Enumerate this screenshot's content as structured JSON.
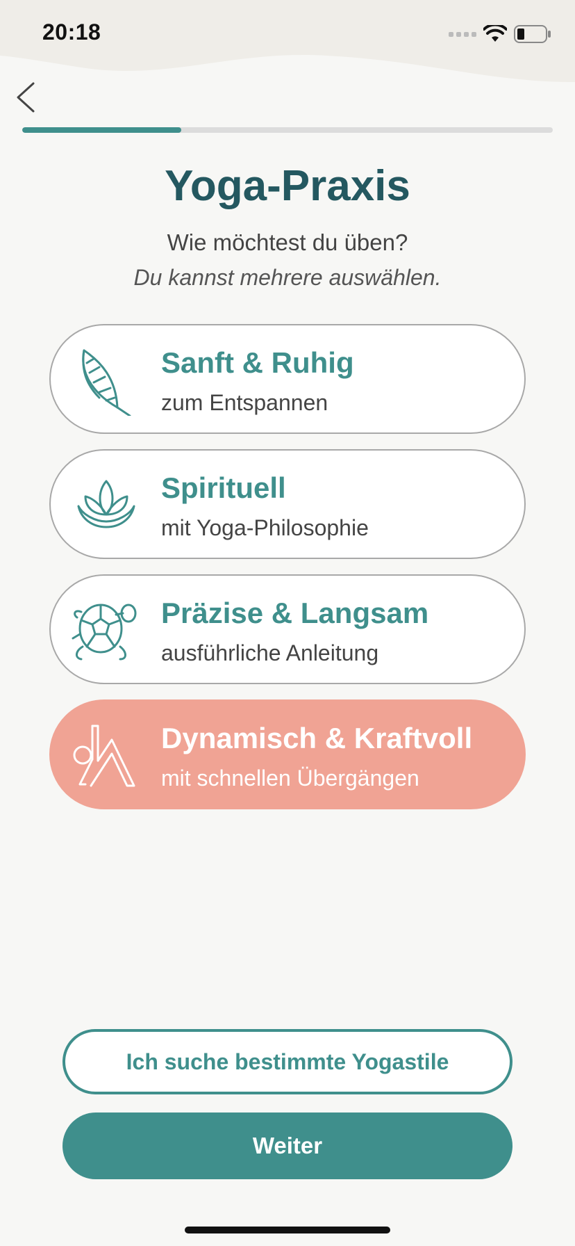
{
  "status_bar": {
    "time": "20:18"
  },
  "progress": {
    "fraction": 0.3
  },
  "header": {
    "title": "Yoga-Praxis",
    "subtitle": "Wie möchtest du üben?",
    "hint": "Du kannst mehrere auswählen."
  },
  "options": [
    {
      "title": "Sanft & Ruhig",
      "subtitle": "zum Entspannen",
      "icon": "feather-icon",
      "selected": false
    },
    {
      "title": "Spirituell",
      "subtitle": "mit Yoga-Philosophie",
      "icon": "lotus-icon",
      "selected": false
    },
    {
      "title": "Präzise & Langsam",
      "subtitle": "ausführliche Anleitung",
      "icon": "turtle-icon",
      "selected": false
    },
    {
      "title": "Dynamisch & Kraftvoll",
      "subtitle": "mit schnellen Übergängen",
      "icon": "yoga-pose-icon",
      "selected": true
    }
  ],
  "buttons": {
    "styles_label": "Ich suche bestimmte Yogastile",
    "next_label": "Weiter"
  },
  "colors": {
    "accent": "#3f8f8c",
    "title": "#245860",
    "selected": "#f0a394",
    "background": "#f7f7f5"
  }
}
